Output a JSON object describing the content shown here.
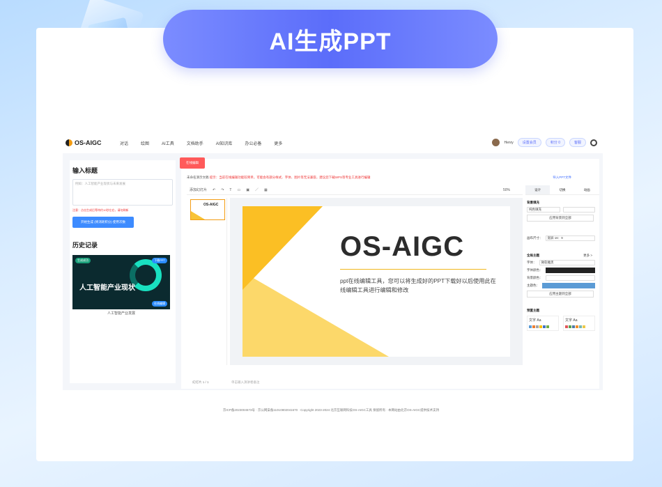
{
  "banner": {
    "title": "AI生成PPT"
  },
  "topnav": {
    "logo": "OS-AIGC",
    "items": [
      "对话",
      "绘图",
      "AI工具",
      "文档助手",
      "AI知识库",
      "办公必备",
      "更多"
    ],
    "user": "Henry",
    "member_label": "设置会员",
    "points_label": "积分 0",
    "notify_label": "客服"
  },
  "left": {
    "title": "输入标题",
    "placeholder": "例如：人工智能产业现状与未来发展",
    "warning": "注意：点击生成后等待约10秒左右，请勿刷新",
    "generate_btn": "开始生成 (将消耗积分) 使用次数",
    "history_title": "历史记录",
    "history_item": {
      "badge_left": "生成成功",
      "badge_right": "下载PPT",
      "title": "人工智能产业现状",
      "badge_bottom": "在线编辑",
      "caption": "人工智能产业发展"
    }
  },
  "workspace": {
    "online_edit_btn": "在线编辑",
    "notice_prefix": "未命名演示文稿",
    "notice": "提示：当前在线编辑功能较简单，可能会有部分样式、字体、图片等无法兼容，建议您下载WPS等专业工具进行编辑",
    "export_label": "导入PPT文件",
    "toolbar_first": "添加幻灯片",
    "zoom": "50%",
    "tabs": [
      "设计",
      "切换",
      "动画"
    ],
    "page_indicator": "幻灯片 1 / 1",
    "notes_placeholder": "单击输入演讲者备注",
    "mini_title": "OS-AIGC"
  },
  "slide": {
    "title": "OS-AIGC",
    "subtitle": "ppt在线编辑工具，您可以将生成好的PPT下载好以后使用此在线编辑工具进行编辑和修改"
  },
  "props": {
    "bg_section": "背景填充",
    "fill_label": "纯色填充",
    "apply_bg_btn": "应用背景到全部",
    "ratio_label": "画布尺寸：",
    "ratio_value": "宽屏 16：9",
    "theme_section": "全局主题",
    "more": "更多 >",
    "font_label": "字体：",
    "font_value": "微软雅黑",
    "font_color_label": "字体颜色：",
    "bg_color_label": "背景颜色：",
    "theme_color_label": "主题色：",
    "apply_theme_btn": "应用主题到全部",
    "preset_section": "预置主题",
    "preset_sample": "文字 Aa"
  },
  "footer": {
    "text": "京ICP备2023004573号  ·  京公网安备11010802041670  ·  Copyright 2023-2024 北京互联网科技OS-AIGC工具 保留所有  ·  本网站由北京OS-AIGC提供技术支持"
  }
}
